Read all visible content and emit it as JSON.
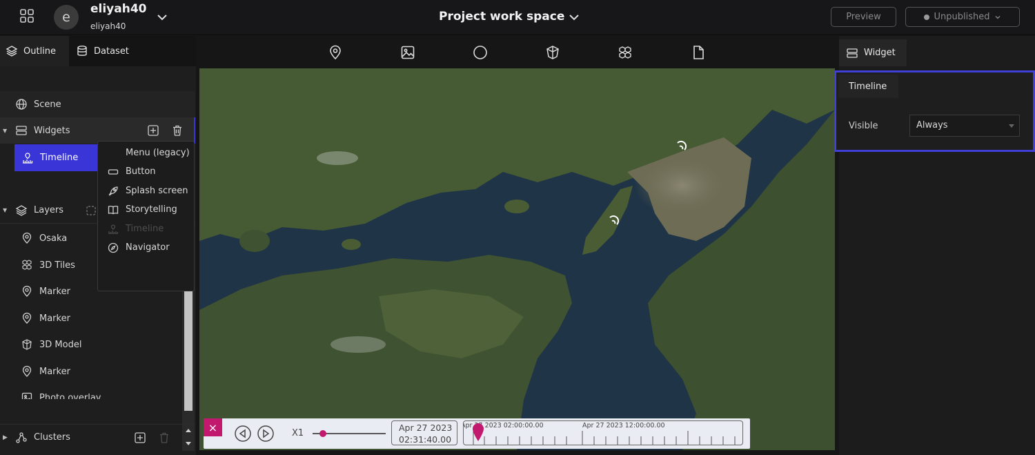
{
  "header": {
    "workspace_name": "eliyah40",
    "workspace_sub": "eliyah40",
    "avatar_letter": "e",
    "project_title": "Project work space",
    "preview_label": "Preview",
    "publish_status": "Unpublished"
  },
  "left_panel": {
    "tabs": [
      {
        "label": "Outline",
        "icon": "layers-icon"
      },
      {
        "label": "Dataset",
        "icon": "database-icon"
      }
    ],
    "scene_label": "Scene",
    "widgets_label": "Widgets",
    "selected_widget": "Timeline",
    "layers_label": "Layers",
    "layers": [
      {
        "label": "Osaka",
        "icon": "marker-icon"
      },
      {
        "label": "3D Tiles",
        "icon": "3d-tiles-icon"
      },
      {
        "label": "Marker",
        "icon": "marker-icon"
      },
      {
        "label": "Marker",
        "icon": "marker-icon"
      },
      {
        "label": "3D Model",
        "icon": "3d-model-icon"
      },
      {
        "label": "Marker",
        "icon": "marker-icon"
      },
      {
        "label": "Photo overlay",
        "icon": "image-icon"
      }
    ],
    "clusters_label": "Clusters"
  },
  "widget_menu": {
    "items": [
      {
        "label": "Menu (legacy)",
        "icon": "",
        "disabled": false
      },
      {
        "label": "Button",
        "icon": "button-icon",
        "disabled": false
      },
      {
        "label": "Splash screen",
        "icon": "rocket-icon",
        "disabled": false
      },
      {
        "label": "Storytelling",
        "icon": "book-icon",
        "disabled": false
      },
      {
        "label": "Timeline",
        "icon": "timeline-icon",
        "disabled": true
      },
      {
        "label": "Navigator",
        "icon": "compass-icon",
        "disabled": false
      }
    ]
  },
  "toolbar": {
    "tools": [
      "marker-icon",
      "image-icon",
      "sphere-icon",
      "3d-model-icon",
      "3d-tiles-icon",
      "file-icon"
    ]
  },
  "timeline_widget": {
    "speed": "X1",
    "speed_fraction": 0.1,
    "date_line1": "Apr 27 2023",
    "date_line2": "02:31:40.00",
    "scale_label1": "Apr 27 2023 02:00:00.00",
    "scale_label2": "Apr 27 2023 12:00:00.00"
  },
  "right_panel": {
    "tab_label": "Widget",
    "section_tab": "Timeline",
    "visible_label": "Visible",
    "visible_value": "Always"
  },
  "colors": {
    "accent": "#3a35d6",
    "highlight_border": "#4040d8",
    "timeline_pink": "#c2186d"
  }
}
